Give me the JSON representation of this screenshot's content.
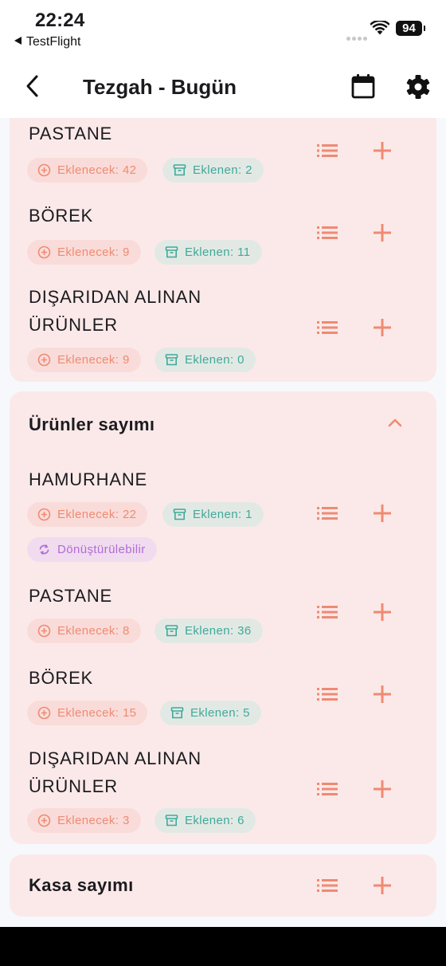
{
  "status": {
    "time": "22:24",
    "back_app": "TestFlight",
    "battery": "94"
  },
  "appbar": {
    "title": "Tezgah - Bugün"
  },
  "colors": {
    "accent": "#ef8a72",
    "teal": "#3fa99a",
    "purple": "#b26bd8",
    "card": "#fbe9e9"
  },
  "card1": {
    "items": [
      {
        "name": "PASTANE",
        "eklenecek": "Eklenecek: 42",
        "eklenen": "Eklenen: 2"
      },
      {
        "name": "BÖREK",
        "eklenecek": "Eklenecek: 9",
        "eklenen": "Eklenen: 11"
      },
      {
        "name_line1": "DIŞARIDAN ALINAN",
        "name_line2": "ÜRÜNLER",
        "eklenecek": "Eklenecek: 9",
        "eklenen": "Eklenen: 0"
      }
    ]
  },
  "card2": {
    "title": "Ürünler sayımı",
    "items": [
      {
        "name": "HAMURHANE",
        "eklenecek": "Eklenecek: 22",
        "eklenen": "Eklenen: 1",
        "badge": "Dönüştürülebilir"
      },
      {
        "name": "PASTANE",
        "eklenecek": "Eklenecek: 8",
        "eklenen": "Eklenen: 36"
      },
      {
        "name": "BÖREK",
        "eklenecek": "Eklenecek: 15",
        "eklenen": "Eklenen: 5"
      },
      {
        "name_line1": "DIŞARIDAN ALINAN",
        "name_line2": "ÜRÜNLER",
        "eklenecek": "Eklenecek: 3",
        "eklenen": "Eklenen: 6"
      }
    ]
  },
  "card3": {
    "title": "Kasa sayımı"
  }
}
